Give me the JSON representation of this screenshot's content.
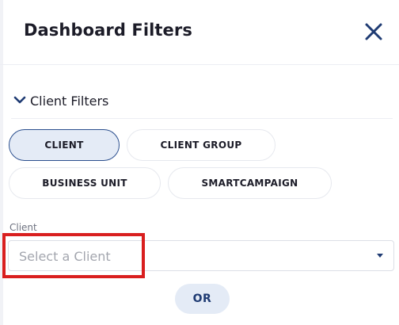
{
  "header": {
    "title": "Dashboard Filters",
    "close_icon": "close-icon"
  },
  "section": {
    "label": "Client Filters",
    "expanded": true,
    "chevron_icon": "chevron-down-icon"
  },
  "filter_types": [
    {
      "label": "CLIENT",
      "selected": true
    },
    {
      "label": "CLIENT GROUP",
      "selected": false
    },
    {
      "label": "BUSINESS UNIT",
      "selected": false
    },
    {
      "label": "SMARTCAMPAIGN",
      "selected": false
    }
  ],
  "client_field": {
    "label": "Client",
    "placeholder": "Select a Client",
    "dropdown_icon": "dropdown-arrow-icon"
  },
  "or_button": {
    "label": "OR"
  },
  "colors": {
    "accent": "#1f3b73",
    "selected_bg": "#e4ebf6",
    "highlight": "#d91f1f"
  }
}
